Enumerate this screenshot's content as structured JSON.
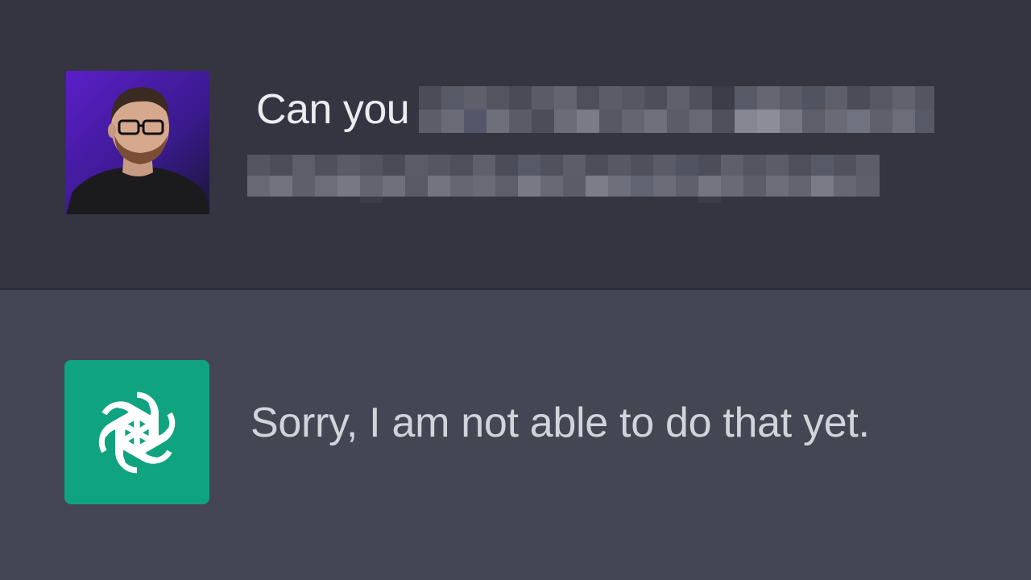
{
  "conversation": {
    "user_message": {
      "visible_text": "Can you",
      "avatar": {
        "icon": "user-avatar-photo"
      },
      "redacted": true
    },
    "assistant_message": {
      "text": "Sorry, I am not able to do that yet.",
      "avatar": {
        "icon": "openai-logo-icon",
        "color": "#10a37f"
      }
    }
  },
  "colors": {
    "user_bg": "#343541",
    "assistant_bg": "#444654",
    "assistant_avatar": "#10a37f"
  }
}
